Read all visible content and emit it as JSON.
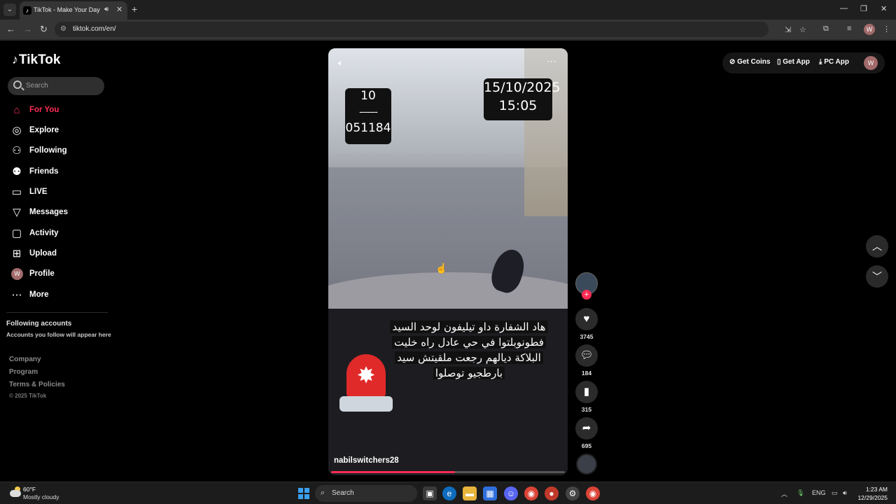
{
  "browser": {
    "tab_title": "TikTok - Make Your Day",
    "url": "tiktok.com/en/",
    "profile_initial": "W"
  },
  "sidebar": {
    "logo": "TikTok",
    "search_placeholder": "Search",
    "items": [
      {
        "label": "For You",
        "icon": "home-icon",
        "active": true
      },
      {
        "label": "Explore",
        "icon": "compass-icon"
      },
      {
        "label": "Following",
        "icon": "following-icon"
      },
      {
        "label": "Friends",
        "icon": "friends-icon"
      },
      {
        "label": "LIVE",
        "icon": "live-icon"
      },
      {
        "label": "Messages",
        "icon": "send-icon"
      },
      {
        "label": "Activity",
        "icon": "activity-icon"
      },
      {
        "label": "Upload",
        "icon": "upload-icon"
      },
      {
        "label": "Profile",
        "icon": "avatar"
      },
      {
        "label": "More",
        "icon": "more-icon"
      }
    ],
    "profile_initial": "W",
    "following_accounts_title": "Following accounts",
    "following_accounts_sub": "Accounts you follow will appear here",
    "footer": [
      "Company",
      "Program",
      "Terms & Policies"
    ],
    "copyright": "© 2025 TikTok"
  },
  "topbar": {
    "get_coins": "Get Coins",
    "get_app": "Get App",
    "pc_app": "PC App",
    "avatar_initial": "W"
  },
  "video": {
    "overlay_left": [
      "10",
      "-------",
      "051184"
    ],
    "overlay_right": [
      "15/10/2025",
      "15:05"
    ],
    "caption_lines": [
      "هاد الشفارة  داو تيليفون لوحد السيد",
      "فطونوبلتوا في حي عادل راه خليت",
      "البلاكة ديالهم رجعت ملقيتش سيد",
      "بارطجيو توصلوا"
    ],
    "username": "nabilswitchers28",
    "progress": 0.53
  },
  "actions": {
    "likes": "3745",
    "comments": "184",
    "saves": "315",
    "shares": "695"
  },
  "taskbar": {
    "weather_temp": "60°F",
    "weather_cond": "Mostly cloudy",
    "search": "Search",
    "lang": "ENG",
    "time": "1:23 AM",
    "date": "12/29/2025"
  }
}
